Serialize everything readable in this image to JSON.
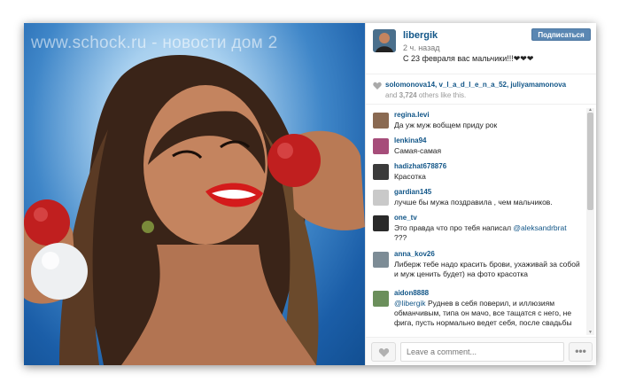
{
  "photo": {
    "watermark": "www.schock.ru - новости дом 2"
  },
  "post": {
    "username": "libergik",
    "time": "2 ч. назад",
    "caption": "С 23 февраля вас мальчики!!!❤❤❤",
    "follow_label": "Подписаться"
  },
  "likes": {
    "likers": "solomonova14, v_l_a_d_l_e_n_a_52, juliyamamonova",
    "and_label": "and",
    "count": "3,724",
    "others_label": "others like this."
  },
  "comments": [
    {
      "user": "regina.levi",
      "text": "Да уж муж вобщем приду рок",
      "avatar_color": "#8a6a52"
    },
    {
      "user": "lenkina94",
      "text": "Самая-самая",
      "avatar_color": "#a64d7a"
    },
    {
      "user": "hadizhat678876",
      "text": "Красотка",
      "avatar_color": "#3b3b3b"
    },
    {
      "user": "gardian145",
      "text": "лучше бы мужа поздравила , чем мальчиков.",
      "avatar_color": "#c9c9c9"
    },
    {
      "user": "one_tv",
      "mention": "@aleksandrbrat",
      "text": "Это правда что про тебя написал",
      "text_after": "???",
      "avatar_color": "#2a2a2a"
    },
    {
      "user": "anna_kov26",
      "text": "Либерж тебе надо красить брови, ухаживай за собой и муж ценить будет) на фото красотка",
      "avatar_color": "#7d8c96"
    },
    {
      "user": "aidon8888",
      "mention": "@libergik",
      "text": "Руднев в себя поверил, и иллюзиям обманчивым, типа он мачо, все тащатся с него, не фига, пусть нормально ведет себя, после свадьбы",
      "avatar_color": "#6b8f5b"
    }
  ],
  "footer": {
    "comment_placeholder": "Leave a comment...",
    "more_label": "•••"
  },
  "colors": {
    "link": "#125688",
    "follow_button": "#5a87b3"
  }
}
